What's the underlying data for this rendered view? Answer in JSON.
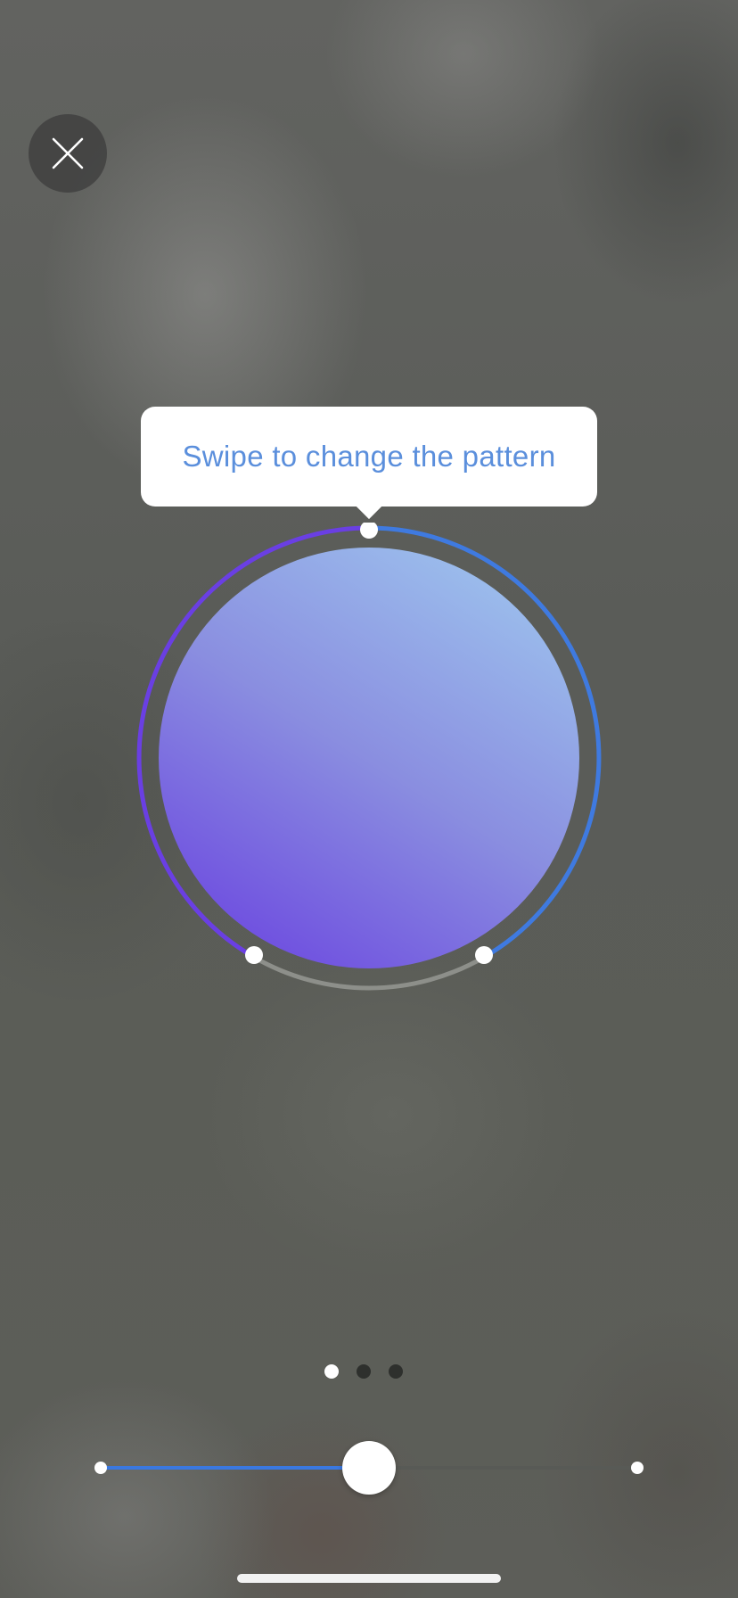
{
  "close_button": {
    "icon": "close-icon"
  },
  "tooltip": {
    "text": "Swipe to change the pattern"
  },
  "pattern_dial": {
    "colors": {
      "gradient_light": "#9bbdec",
      "gradient_mid": "#8a8ee0",
      "gradient_dark": "#6f4fe0",
      "ring_purple": "#6a3fe3",
      "ring_blue": "#3f7ae0",
      "ring_gray": "#8d8f8a"
    }
  },
  "pagination": {
    "count": 3,
    "active_index": 0
  },
  "slider": {
    "value": 0.5,
    "colors": {
      "fill": "#3a78e0",
      "track": "#585a56"
    }
  },
  "accent_color": "#5b8fdc"
}
